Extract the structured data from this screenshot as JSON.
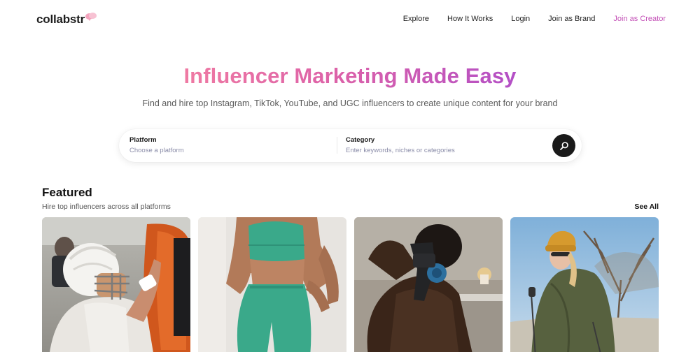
{
  "header": {
    "logo_text": "collabstr",
    "nav": [
      {
        "label": "Explore"
      },
      {
        "label": "How It Works"
      },
      {
        "label": "Login"
      },
      {
        "label": "Join as Brand"
      },
      {
        "label": "Join as Creator"
      }
    ]
  },
  "hero": {
    "title": "Influencer Marketing Made Easy",
    "subtitle": "Find and hire top Instagram, TikTok, YouTube, and UGC influencers to create unique content for your brand"
  },
  "search": {
    "platform_label": "Platform",
    "platform_placeholder": "Choose a platform",
    "category_label": "Category",
    "category_placeholder": "Enter keywords, niches or categories",
    "button_icon": "search-icon"
  },
  "featured": {
    "title": "Featured",
    "subtitle": "Hire top influencers across all platforms",
    "see_all": "See All",
    "cards": [
      {
        "image": "football-player-photo"
      },
      {
        "image": "fitness-model-photo"
      },
      {
        "image": "massage-gun-photo"
      },
      {
        "image": "hiker-photo"
      }
    ]
  },
  "colors": {
    "accent_pink": "#ef7aa3",
    "accent_purple": "#b34fc6",
    "join_creator": "#c34fb6",
    "button_dark": "#1a1a1a"
  }
}
